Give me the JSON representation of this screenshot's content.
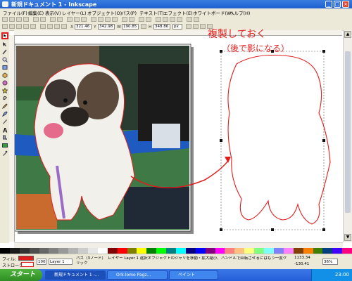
{
  "window": {
    "title": "新規ドキュメント 1 - Inkscape",
    "minimize": "_",
    "maximize": "□",
    "close": "×"
  },
  "menu": [
    "ファイル(F)",
    "編集(E)",
    "表示(V)",
    "レイヤー(L)",
    "オブジェクト(O)",
    "パス(P)",
    "テキスト(T)",
    "エフェクト(E)",
    "ホワイトボード(W)",
    "ヘルプ(H)"
  ],
  "controls": {
    "x_label": "X",
    "x_value": "321.46",
    "y_label": "Y",
    "y_value": "342.98",
    "w_label": "W",
    "w_value": "190.85",
    "h_label": "H",
    "h_value": "348.86",
    "unit": "px"
  },
  "annotation": {
    "line1": "複製しておく",
    "line2": "（後で影になる）"
  },
  "statusbar": {
    "fill_label": "フィル:",
    "stroke_label": "ストローク:",
    "opacity": "100",
    "layer": "Layer 1",
    "message": "パス（3ノード）　レイヤー Layer 1 選択オブジェクトのジャリを移動・拡大縮小、ハンドルで回転させるにはもう一度クリック",
    "x_coord": "1133.34",
    "y_coord": "-130.41",
    "zoom": "36%"
  },
  "taskbar": {
    "start": "スタート",
    "items": [
      "新規ドキュメント 1 -...",
      "Ork-lomo Pagz...",
      "ペイント"
    ],
    "clock": "23:00"
  },
  "colors": {
    "accent_red": "#e21c1c",
    "title_blue": "#245ed8",
    "chrome": "#ece9d8"
  }
}
